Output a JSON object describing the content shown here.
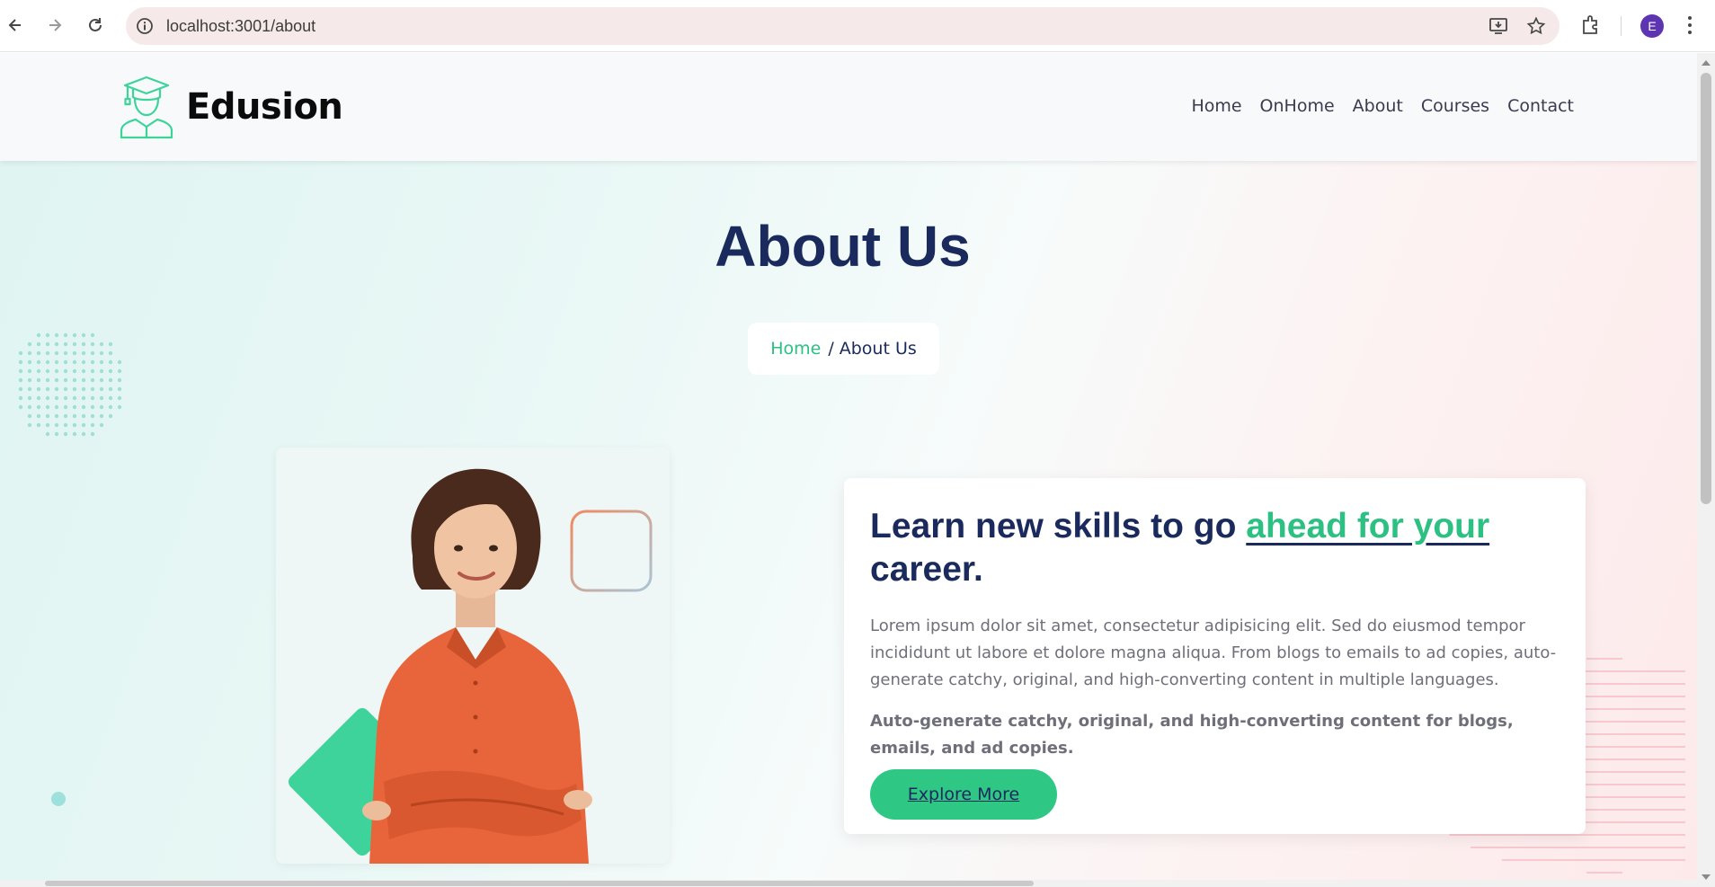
{
  "browser": {
    "url": "localhost:3001/about",
    "profile_initial": "E",
    "icons": [
      "back-arrow-icon",
      "forward-arrow-icon",
      "reload-icon",
      "site-info-icon",
      "install-app-icon",
      "bookmark-star-icon",
      "extensions-icon",
      "more-menu-icon"
    ]
  },
  "header": {
    "brand": "Edusion",
    "nav": [
      "Home",
      "OnHome",
      "About",
      "Courses",
      "Contact"
    ]
  },
  "hero": {
    "title": "About Us",
    "breadcrumb_home": "Home",
    "breadcrumb_sep": "/",
    "breadcrumb_current": "About Us"
  },
  "about": {
    "heading_start": "Learn new skills to go ",
    "heading_highlight": "ahead for your",
    "heading_end": " career.",
    "paragraph": "Lorem ipsum dolor sit amet, consectetur adipisicing elit. Sed do eiusmod tempor incididunt ut labore et dolore magna aliqua. From blogs to emails to ad copies, auto-generate catchy, original, and high-converting content in multiple languages.",
    "bold_paragraph": "Auto-generate catchy, original, and high-converting content for blogs, emails, and ad copies.",
    "button": "Explore More"
  },
  "colors": {
    "accent": "#2cc083",
    "navy": "#1b2a5c",
    "shirt": "#e8643a"
  }
}
